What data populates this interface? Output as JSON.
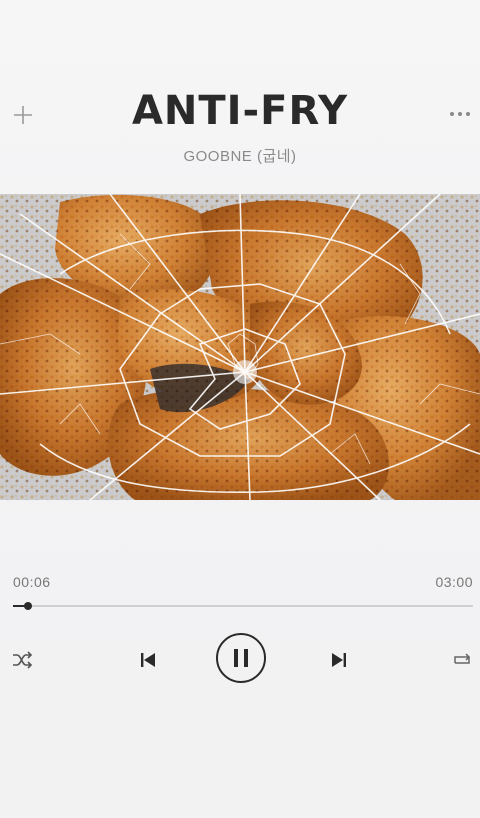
{
  "song": {
    "title": "ANTI-FRY",
    "artist": "GOOBNE (굽네)"
  },
  "artwork": {
    "icon": "fried-chicken-cracked-glass-artwork"
  },
  "playback": {
    "elapsed": "00:06",
    "total": "03:00",
    "progress_fraction": 0.033,
    "state": "playing"
  },
  "controls": {
    "add_icon": "plus-icon",
    "more_icon": "more-dots-icon",
    "shuffle_icon": "shuffle-icon",
    "prev_icon": "skip-previous-icon",
    "pause_icon": "pause-icon",
    "next_icon": "skip-next-icon",
    "repeat_icon": "repeat-icon"
  },
  "colors": {
    "background": "#f4f4f5",
    "text_primary": "#2a2a2a",
    "text_secondary": "#8a8a8a",
    "chicken": "#c8782f"
  }
}
